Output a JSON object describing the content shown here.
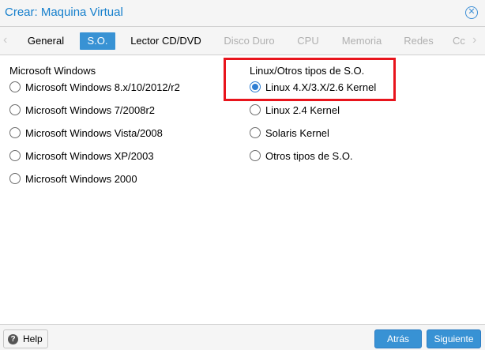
{
  "window": {
    "title": "Crear: Maquina Virtual",
    "close_icon": "close-circle-icon"
  },
  "tabs": {
    "items": [
      {
        "label": "General",
        "state": "enabled"
      },
      {
        "label": "S.O.",
        "state": "active"
      },
      {
        "label": "Lector CD/DVD",
        "state": "enabled"
      },
      {
        "label": "Disco Duro",
        "state": "disabled"
      },
      {
        "label": "CPU",
        "state": "disabled"
      },
      {
        "label": "Memoria",
        "state": "disabled"
      },
      {
        "label": "Redes",
        "state": "disabled"
      },
      {
        "label": "Cc",
        "state": "disabled"
      }
    ],
    "scroll_left_glyph": "‹",
    "scroll_right_glyph": "›"
  },
  "windows_group": {
    "title": "Microsoft Windows",
    "options": [
      {
        "label": "Microsoft Windows 8.x/10/2012/r2",
        "checked": false
      },
      {
        "label": "Microsoft Windows 7/2008r2",
        "checked": false
      },
      {
        "label": "Microsoft Windows Vista/2008",
        "checked": false
      },
      {
        "label": "Microsoft Windows XP/2003",
        "checked": false
      },
      {
        "label": "Microsoft Windows 2000",
        "checked": false
      }
    ]
  },
  "linux_group": {
    "title": "Linux/Otros tipos de S.O.",
    "options": [
      {
        "label": "Linux 4.X/3.X/2.6 Kernel",
        "checked": true
      },
      {
        "label": "Linux 2.4 Kernel",
        "checked": false
      },
      {
        "label": "Solaris Kernel",
        "checked": false
      },
      {
        "label": "Otros tipos de S.O.",
        "checked": false
      }
    ],
    "highlight_color": "#e8141c"
  },
  "footer": {
    "help_label": "Help",
    "help_icon": "question-circle-icon",
    "back_label": "Atrás",
    "next_label": "Siguiente"
  },
  "colors": {
    "accent": "#3892d4",
    "title_text": "#157fcc"
  }
}
